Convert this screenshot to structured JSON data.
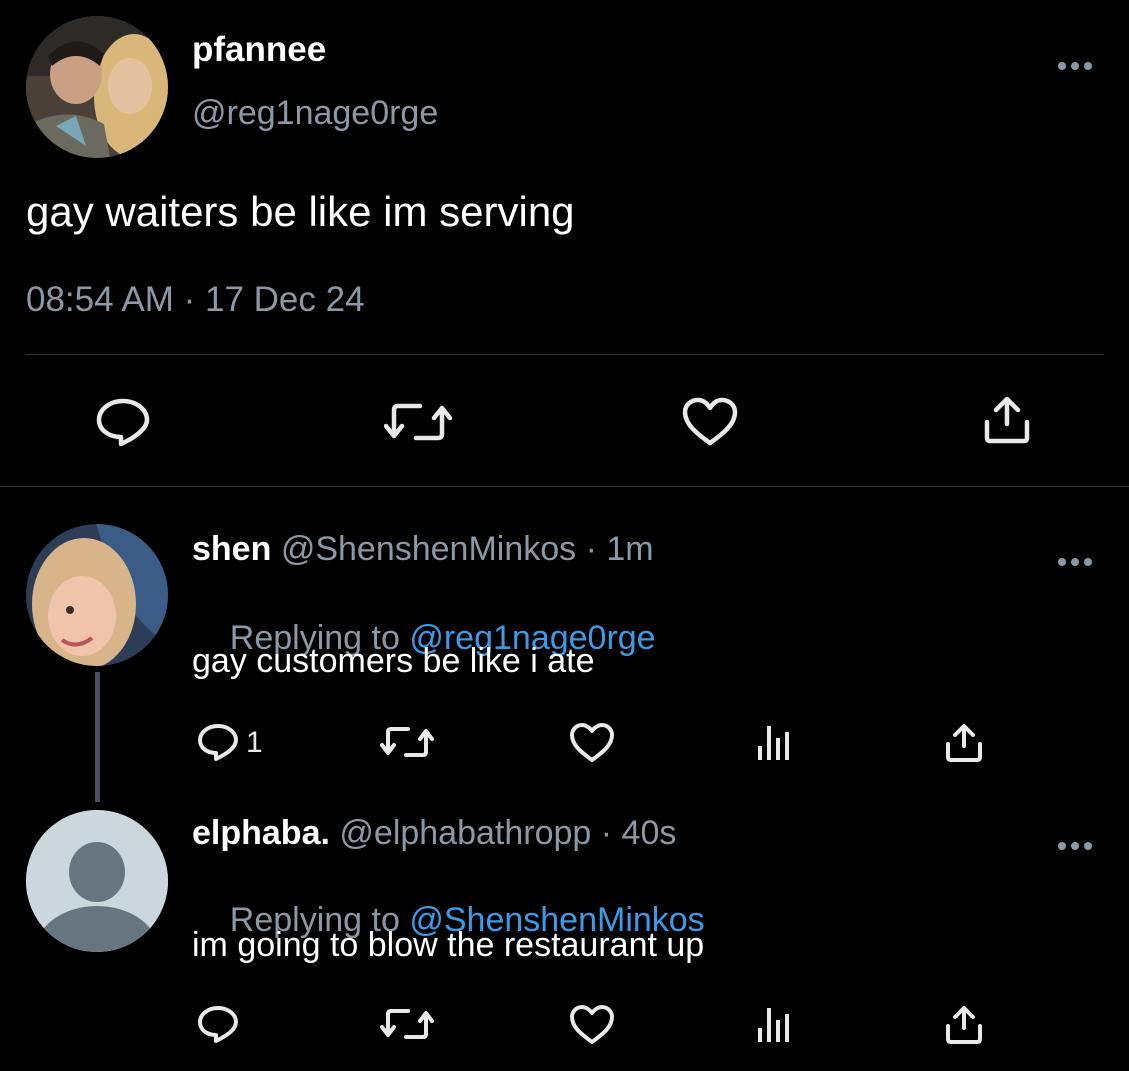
{
  "main_tweet": {
    "display_name": "pfannee",
    "handle": "@reg1nage0rge",
    "text": "gay waiters be like im serving",
    "timestamp": "08:54 AM · 17 Dec 24"
  },
  "replies": [
    {
      "display_name": "shen",
      "handle_time": "@ShenshenMinkos · 1m",
      "replying_prefix": "Replying to ",
      "replying_to": "@reg1nage0rge",
      "text": "gay customers be like i ate",
      "reply_count": "1"
    },
    {
      "display_name": "elphaba.",
      "handle_time": "@elphabathropp · 40s",
      "replying_prefix": "Replying to ",
      "replying_to": "@ShenshenMinkos",
      "text": "im going to blow the restaurant up",
      "reply_count": ""
    }
  ],
  "colors": {
    "background": "#000000",
    "text": "#e7e9ea",
    "muted": "#8b98a5",
    "link": "#3b9be8"
  },
  "icons": [
    "more-icon",
    "reply-icon",
    "retweet-icon",
    "like-icon",
    "share-icon",
    "analytics-icon"
  ]
}
